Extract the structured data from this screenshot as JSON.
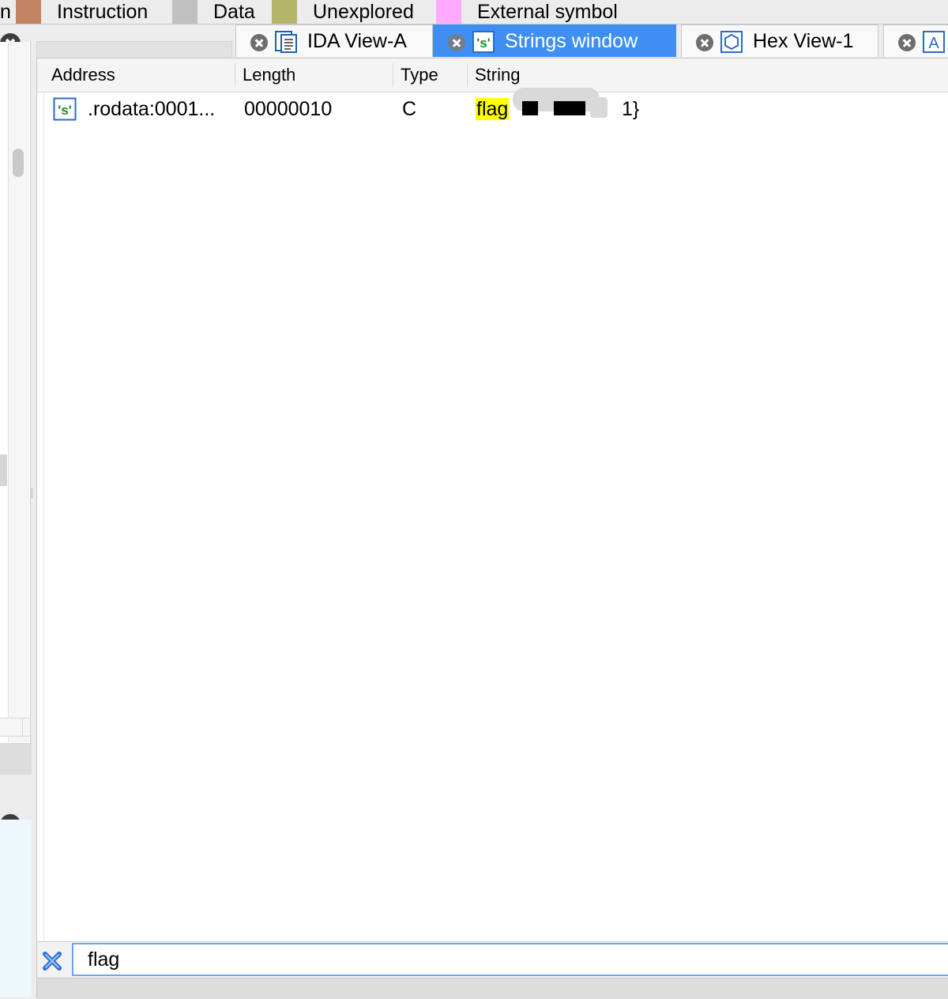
{
  "legend": {
    "items": [
      {
        "label": "n",
        "color": null
      },
      {
        "label": "Instruction",
        "color": "#c28463"
      },
      {
        "label": "Data",
        "color": "#c0c0c0"
      },
      {
        "label": "Unexplored",
        "color": "#b3b56a"
      },
      {
        "label": "External symbol",
        "color": "#ffaaff"
      }
    ]
  },
  "tabs": [
    {
      "label": "IDA View-A",
      "icon": "ida-view-icon",
      "active": false
    },
    {
      "label": "Strings window",
      "icon": "strings-icon",
      "active": true
    },
    {
      "label": "Hex View-1",
      "icon": "hex-view-icon",
      "active": false
    },
    {
      "label": "",
      "icon": "structures-icon",
      "active": false
    }
  ],
  "table": {
    "columns": [
      "Address",
      "Length",
      "Type",
      "String"
    ],
    "rows": [
      {
        "address": ".rodata:0001...",
        "length": "00000010",
        "type": "C",
        "string_prefix": "flag",
        "string_suffix": "1}",
        "redacted": true,
        "icon": "string-s-icon"
      }
    ]
  },
  "filter": {
    "value": "flag",
    "clear_icon": "clear-filter-icon"
  },
  "colors": {
    "accent_tab": "#3f8ff2",
    "highlight": "#ffff00",
    "focus_border": "#6fa3f0"
  }
}
